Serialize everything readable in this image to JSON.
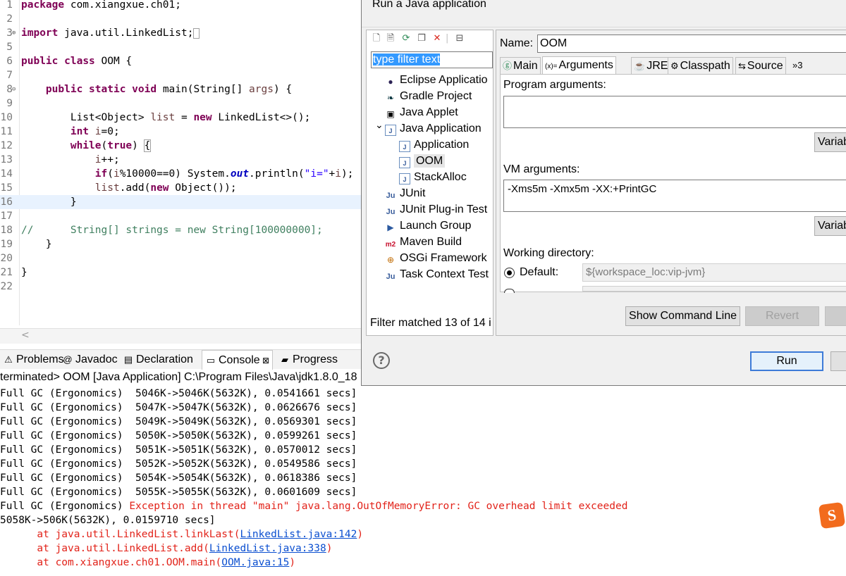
{
  "editor": {
    "lines": [
      {
        "n": "1",
        "fold": "",
        "html": "<span class=\"kw\">package</span> com.xiangxue.ch01;"
      },
      {
        "n": "2",
        "fold": "",
        "html": ""
      },
      {
        "n": "3",
        "fold": "⊕",
        "html": "<span class=\"kw\">import</span> java.util.LinkedList;<span class=\"fold-box\"></span>"
      },
      {
        "n": "5",
        "fold": "",
        "html": ""
      },
      {
        "n": "6",
        "fold": "",
        "html": "<span class=\"kw\">public</span> <span class=\"kw\">class</span> OOM {"
      },
      {
        "n": "7",
        "fold": "",
        "html": ""
      },
      {
        "n": "8",
        "fold": "⊖",
        "html": "    <span class=\"kw\">public</span> <span class=\"kw\">static</span> <span class=\"kw\">void</span> main(String[] <span class=\"var\">args</span>) {"
      },
      {
        "n": "9",
        "fold": "",
        "html": ""
      },
      {
        "n": "10",
        "fold": "",
        "html": "        List&lt;Object&gt; <span class=\"var\">list</span> = <span class=\"kw\">new</span> LinkedList&lt;&gt;();"
      },
      {
        "n": "11",
        "fold": "",
        "html": "        <span class=\"kw\">int</span> <span class=\"var\">i</span>=0;"
      },
      {
        "n": "12",
        "fold": "",
        "html": "        <span class=\"kw\">while</span>(<span class=\"kw\">true</span>) <span class=\"bracket-box\">{</span>"
      },
      {
        "n": "13",
        "fold": "",
        "html": "            <span class=\"var\">i</span>++;"
      },
      {
        "n": "14",
        "fold": "",
        "html": "            <span class=\"kw\">if</span>(<span class=\"var\">i</span>%10000==0) System.<span class=\"fld\">out</span>.println(<span class=\"str\">\"i=\"</span>+<span class=\"var\">i</span>);"
      },
      {
        "n": "15",
        "fold": "",
        "html": "            <span class=\"var\">list</span>.add(<span class=\"kw\">new</span> Object());"
      },
      {
        "n": "16",
        "fold": "",
        "html": "        }",
        "current": true
      },
      {
        "n": "17",
        "fold": "",
        "html": ""
      },
      {
        "n": "18",
        "fold": "",
        "html": "<span class=\"cm\">//      String[] strings = new String[100000000];</span>"
      },
      {
        "n": "19",
        "fold": "",
        "html": "    }"
      },
      {
        "n": "20",
        "fold": "",
        "html": ""
      },
      {
        "n": "21",
        "fold": "",
        "html": "}"
      },
      {
        "n": "22",
        "fold": "",
        "html": ""
      }
    ]
  },
  "views": {
    "tabs": [
      {
        "icon": "⚠",
        "label": "Problems"
      },
      {
        "icon": "@",
        "label": "Javadoc"
      },
      {
        "icon": "▤",
        "label": "Declaration"
      },
      {
        "icon": "▭",
        "label": "Console",
        "close": "⊠"
      },
      {
        "icon": "▰",
        "label": "Progress"
      }
    ],
    "console_header": "terminated> OOM [Java Application] C:\\Program Files\\Java\\jdk1.8.0_18"
  },
  "console": {
    "gc_lines": [
      "Full GC (Ergonomics)  5046K->5046K(5632K), 0.0541661 secs]",
      "Full GC (Ergonomics)  5047K->5047K(5632K), 0.0626676 secs]",
      "Full GC (Ergonomics)  5049K->5049K(5632K), 0.0569301 secs]",
      "Full GC (Ergonomics)  5050K->5050K(5632K), 0.0599261 secs]",
      "Full GC (Ergonomics)  5051K->5051K(5632K), 0.0570012 secs]",
      "Full GC (Ergonomics)  5052K->5052K(5632K), 0.0549586 secs]",
      "Full GC (Ergonomics)  5054K->5054K(5632K), 0.0618386 secs]",
      "Full GC (Ergonomics)  5055K->5055K(5632K), 0.0601609 secs]"
    ],
    "mixed_prefix": "Full GC (Ergonomics) ",
    "exception": "Exception in thread \"main\" java.lang.OutOfMemoryError: GC overhead limit exceeded",
    "tail_line": "5058K->506K(5632K), 0.0159710 secs]",
    "stack": [
      {
        "prefix": "\tat java.util.LinkedList.linkLast(",
        "link": "LinkedList.java:142",
        "suffix": ")"
      },
      {
        "prefix": "\tat java.util.LinkedList.add(",
        "link": "LinkedList.java:338",
        "suffix": ")"
      },
      {
        "prefix": "\tat com.xiangxue.ch01.OOM.main(",
        "link": "OOM.java:15",
        "suffix": ")"
      }
    ]
  },
  "dialog": {
    "title": "Run a Java application",
    "filter_placeholder": "type filter text",
    "tree": [
      {
        "label": "Eclipse Applicatio",
        "icon": "●",
        "indent": 0
      },
      {
        "label": "Gradle Project",
        "icon": "❧",
        "indent": 0
      },
      {
        "label": "Java Applet",
        "icon": "▣",
        "indent": 0
      },
      {
        "label": "Java Application",
        "icon": "J",
        "indent": 0,
        "expanded": true
      },
      {
        "label": "Application",
        "icon": "J",
        "indent": 1
      },
      {
        "label": "OOM",
        "icon": "J",
        "indent": 1,
        "selected": true
      },
      {
        "label": "StackAlloc",
        "icon": "J",
        "indent": 1
      },
      {
        "label": "JUnit",
        "icon": "Ju",
        "indent": 0
      },
      {
        "label": "JUnit Plug-in Test",
        "icon": "Ju",
        "indent": 0
      },
      {
        "label": "Launch Group",
        "icon": "▶",
        "indent": 0
      },
      {
        "label": "Maven Build",
        "icon": "m2",
        "indent": 0
      },
      {
        "label": "OSGi Framework",
        "icon": "⊕",
        "indent": 0
      },
      {
        "label": "Task Context Test",
        "icon": "Ju",
        "indent": 0
      }
    ],
    "filter_status": "Filter matched 13 of 14 i",
    "name_label": "Name:",
    "name_value": "OOM",
    "tabs": [
      {
        "icon": "ⓖ",
        "label": "Main"
      },
      {
        "icon": "(x)=",
        "label": "Arguments",
        "active": true
      },
      {
        "icon": "☕",
        "label": "JRE"
      },
      {
        "icon": "⚙",
        "label": "Classpath"
      },
      {
        "icon": "⇆",
        "label": "Source"
      },
      {
        "icon": "",
        "label": "»3"
      }
    ],
    "program_args_label": "Program arguments:",
    "program_args_value": "",
    "variables_btn": "Variab",
    "vm_args_label": "VM arguments:",
    "vm_args_value": "-Xms5m -Xmx5m -XX:+PrintGC",
    "working_dir_label": "Working directory:",
    "default_label": "Default:",
    "default_value": "${workspace_loc:vip-jvm}",
    "show_cmd_btn": "Show Command Line",
    "revert_btn": "Revert",
    "run_btn": "Run",
    "help": "?"
  },
  "sogou": "S"
}
